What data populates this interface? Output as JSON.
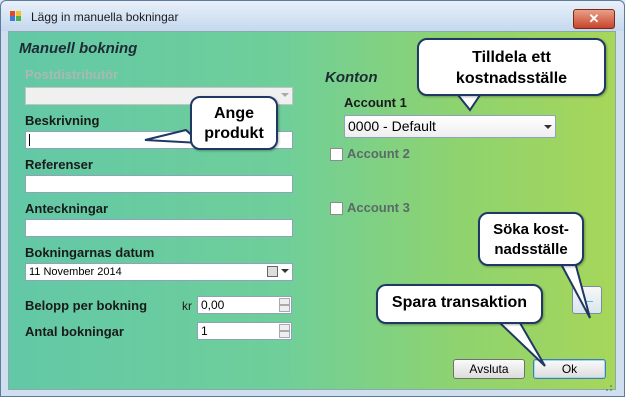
{
  "window": {
    "title": "Lägg in manuella bokningar",
    "close_glyph": "✕",
    "app_icon": "app-icon"
  },
  "left": {
    "section_title": "Manuell bokning",
    "postdistributor_label": "Postdistributör",
    "postdistributor_value": "",
    "description_label": "Beskrivning",
    "description_value": "",
    "references_label": "Referenser",
    "references_value": "",
    "notes_label": "Anteckningar",
    "notes_value": "",
    "date_label": "Bokningarnas datum",
    "date_value": "11 November 2014",
    "amount_label": "Belopp per bokning",
    "amount_currency": "kr",
    "amount_value": "0,00",
    "count_label": "Antal bokningar",
    "count_value": "1"
  },
  "right": {
    "section_title": "Konton",
    "account1_label": "Account 1",
    "account1_value": "0000 - Default",
    "account2_label": "Account 2",
    "account3_label": "Account 3",
    "search_glyph": "←"
  },
  "buttons": {
    "cancel": "Avsluta",
    "ok": "Ok"
  },
  "callouts": {
    "product": "Ange produkt",
    "cost_center": "Tilldela ett kostnadsställe",
    "search": "Söka kost-nadsställe",
    "save": "Spara transaktion"
  },
  "colors": {
    "callout_border": "#1f3864",
    "gradient_left": "#62c8a6",
    "gradient_right": "#a7d65a"
  }
}
